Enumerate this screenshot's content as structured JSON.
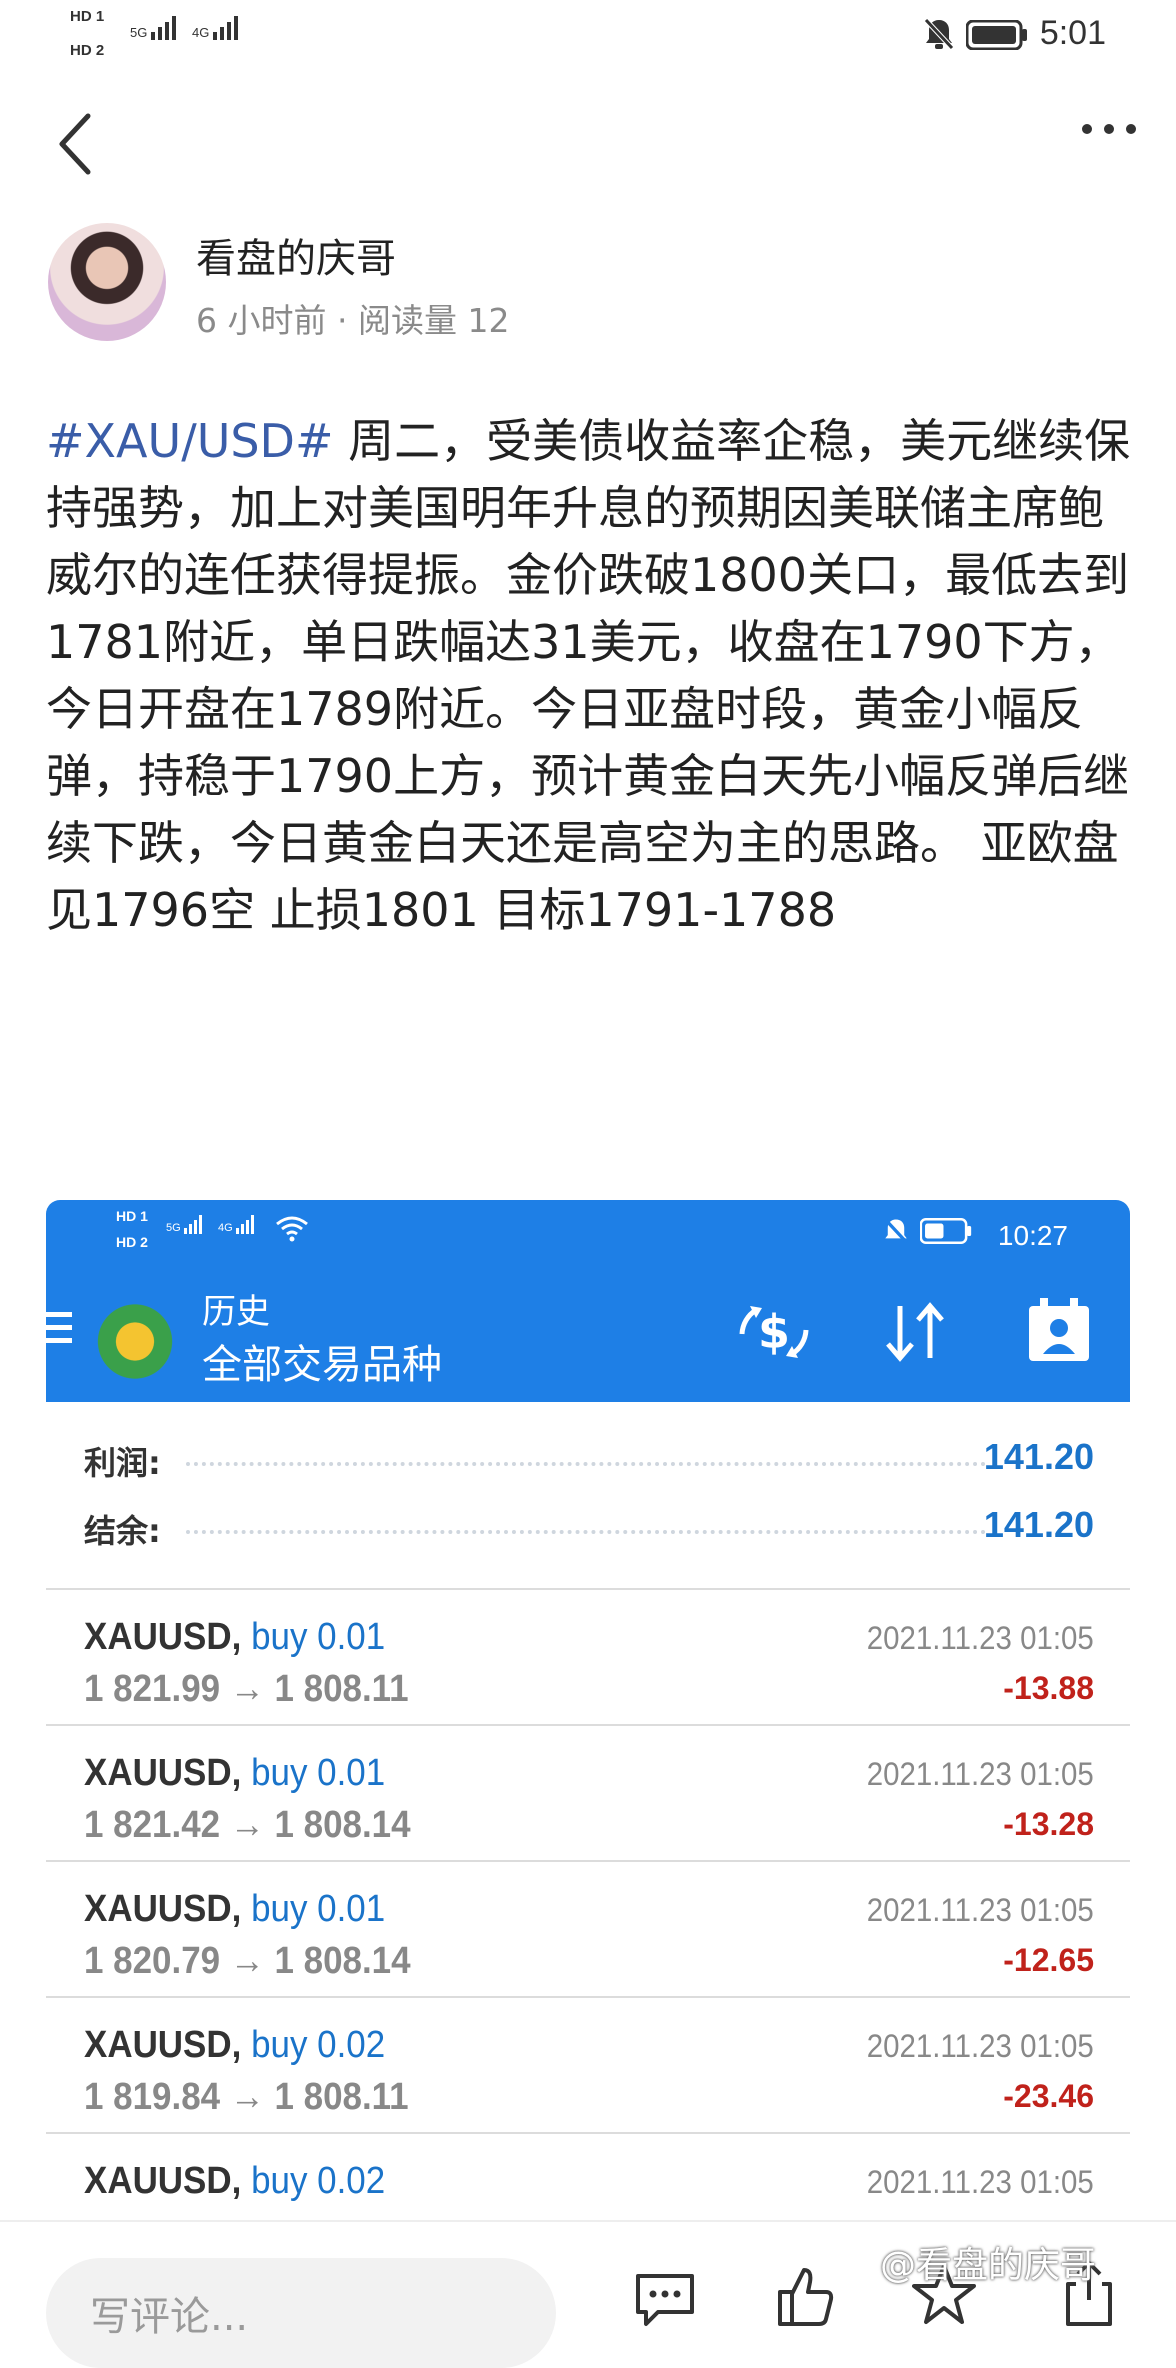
{
  "status_bar": {
    "hd1": "HD 1",
    "hd2": "HD 2",
    "net1": "5G",
    "net2": "4G",
    "time": "5:01"
  },
  "post": {
    "author": "看盘的庆哥",
    "meta": "6 小时前 · 阅读量 12",
    "hashtag": "#XAU/USD#",
    "body": " 周二，受美债收益率企稳，美元继续保持强势，加上对美国明年升息的预期因美联储主席鲍威尔的连任获得提振。金价跌破1800关口，最低去到1781附近，单日跌幅达31美元，收盘在1790下方，今日开盘在1789附近。今日亚盘时段，黄金小幅反弹，持稳于1790上方，预计黄金白天先小幅反弹后继续下跌，今日黄金白天还是高空为主的思路。 亚欧盘见1796空 止损1801 目标1791-1788"
  },
  "screenshot": {
    "status": {
      "hd1": "HD 1",
      "hd2": "HD 2",
      "net1": "5G",
      "net2": "4G",
      "time": "10:27"
    },
    "header": {
      "title": "历史",
      "subtitle": "全部交易品种"
    },
    "summary": [
      {
        "label": "利润:",
        "value": "141.20"
      },
      {
        "label": "结余:",
        "value": "141.20"
      }
    ],
    "trades": [
      {
        "symbol": "XAUUSD,",
        "side": "buy 0.01",
        "prices": "1 821.99 → 1 808.11",
        "datetime": "2021.11.23 01:05",
        "profit": "-13.88"
      },
      {
        "symbol": "XAUUSD,",
        "side": "buy 0.01",
        "prices": "1 821.42 → 1 808.14",
        "datetime": "2021.11.23 01:05",
        "profit": "-13.28"
      },
      {
        "symbol": "XAUUSD,",
        "side": "buy 0.01",
        "prices": "1 820.79 → 1 808.14",
        "datetime": "2021.11.23 01:05",
        "profit": "-12.65"
      },
      {
        "symbol": "XAUUSD,",
        "side": "buy 0.02",
        "prices": "1 819.84 → 1 808.11",
        "datetime": "2021.11.23 01:05",
        "profit": "-23.46"
      },
      {
        "symbol": "XAUUSD,",
        "side": "buy 0.02",
        "prices": "",
        "datetime": "2021.11.23 01:05",
        "profit": ""
      }
    ]
  },
  "bottom_bar": {
    "comment_placeholder": "写评论...",
    "watermark": "@看盘的庆哥"
  },
  "colors": {
    "mt_blue": "#1e7fe6",
    "link_blue": "#3a5da8",
    "value_blue": "#1a73c9",
    "loss_red": "#c0221b"
  }
}
